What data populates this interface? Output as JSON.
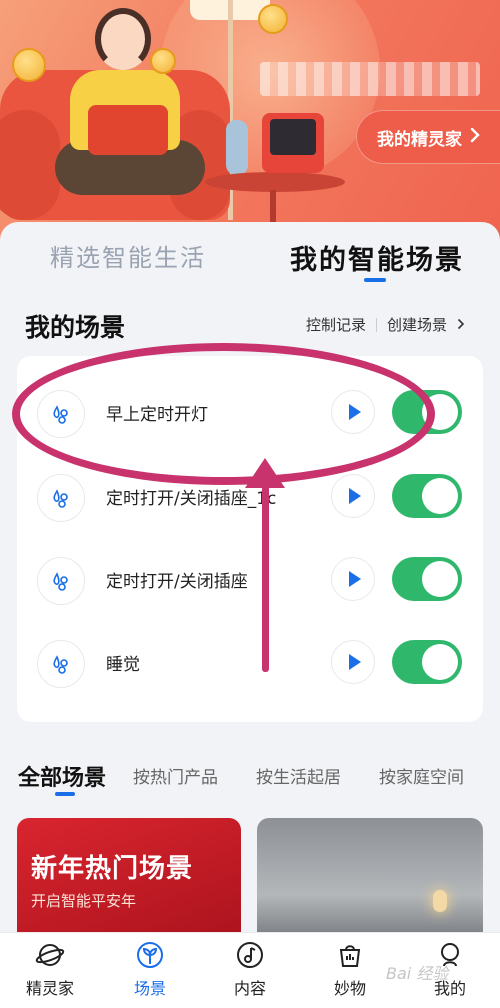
{
  "header": {
    "genie_button": "我的精灵家"
  },
  "tabs": {
    "curated": "精选智能生活",
    "my_scenes": "我的智能场景"
  },
  "my_scenes": {
    "title": "我的场景",
    "control_log": "控制记录",
    "create_scene": "创建场景",
    "items": [
      {
        "name": "早上定时开灯",
        "enabled": true
      },
      {
        "name": "定时打开/关闭插座_1c",
        "enabled": true
      },
      {
        "name": "定时打开/关闭插座",
        "enabled": true
      },
      {
        "name": "睡觉",
        "enabled": true
      }
    ]
  },
  "all_scenes": {
    "title": "全部场景",
    "filters": [
      "按热门产品",
      "按生活起居",
      "按家庭空间"
    ],
    "promo": {
      "title": "新年热门场景",
      "subtitle": "开启智能平安年"
    }
  },
  "bottom_nav": [
    {
      "label": "精灵家",
      "icon": "planet-icon"
    },
    {
      "label": "场景",
      "icon": "sprout-icon",
      "active": true
    },
    {
      "label": "内容",
      "icon": "music-note-icon"
    },
    {
      "label": "妙物",
      "icon": "bag-icon"
    },
    {
      "label": "我的",
      "icon": "person-icon"
    }
  ],
  "watermark": "Bai 经验",
  "colors": {
    "accent": "#1a6ee8",
    "toggle_on": "#2fb86b",
    "annotation": "#c8336d",
    "banner": "#f27a5e"
  }
}
